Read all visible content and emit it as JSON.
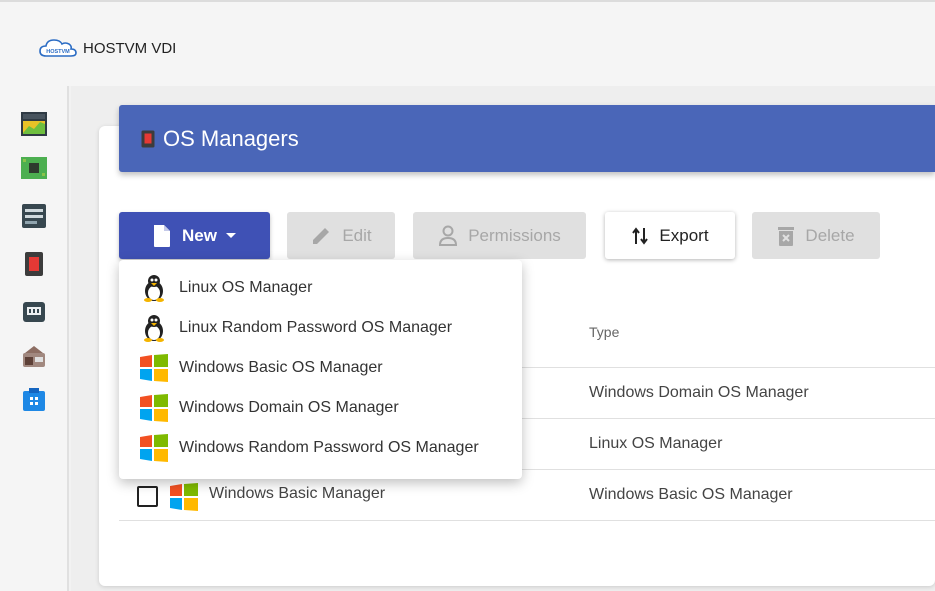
{
  "app": {
    "title": "HOSTVM VDI",
    "logo_text": "HOSTVM"
  },
  "sidebar": {
    "items": [
      {
        "icon": "dashboard-chart-icon"
      },
      {
        "icon": "service-providers-icon"
      },
      {
        "icon": "authenticators-icon"
      },
      {
        "icon": "os-managers-icon"
      },
      {
        "icon": "connectivity-icon"
      },
      {
        "icon": "pools-icon"
      },
      {
        "icon": "tools-icon"
      }
    ]
  },
  "header": {
    "title": "OS Managers"
  },
  "toolbar": {
    "new_label": "New",
    "edit_label": "Edit",
    "permissions_label": "Permissions",
    "export_label": "Export",
    "delete_label": "Delete"
  },
  "dropdown": {
    "items": [
      {
        "label": "Linux OS Manager",
        "icon": "linux-icon"
      },
      {
        "label": "Linux Random Password OS Manager",
        "icon": "linux-icon"
      },
      {
        "label": "Windows Basic OS Manager",
        "icon": "windows-icon"
      },
      {
        "label": "Windows Domain OS Manager",
        "icon": "windows-icon"
      },
      {
        "label": "Windows Random Password OS Manager",
        "icon": "windows-icon"
      }
    ]
  },
  "table": {
    "columns": {
      "type": "Type"
    },
    "rows": [
      {
        "name": "",
        "type": "Windows Domain OS Manager"
      },
      {
        "name": "",
        "type": "Linux OS Manager"
      },
      {
        "name": "Windows Basic Manager",
        "type": "Windows Basic OS Manager"
      }
    ]
  },
  "colors": {
    "header": "#4a66b8",
    "primary_button": "#3f51b5"
  }
}
